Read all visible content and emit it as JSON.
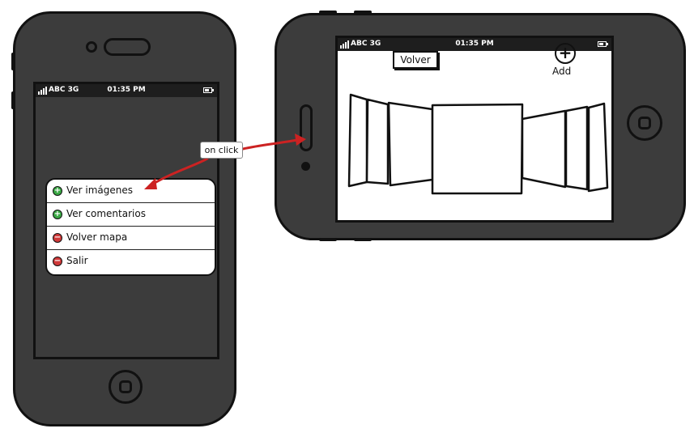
{
  "colors": {
    "phone_body": "#3c3c3c",
    "outline": "#111111",
    "arrow": "#cc2222",
    "add_green": "#3aa844",
    "remove_red": "#d03a3a"
  },
  "portrait": {
    "status": {
      "carrier": "ABC 3G",
      "time": "01:35 PM"
    },
    "menu": {
      "items": [
        {
          "label": "Ver imágenes",
          "icon": "add-circle-icon",
          "icon_glyph": "+"
        },
        {
          "label": "Ver comentarios",
          "icon": "add-circle-icon",
          "icon_glyph": "+"
        },
        {
          "label": "Volver mapa",
          "icon": "remove-circle-icon",
          "icon_glyph": "−"
        },
        {
          "label": "Salir",
          "icon": "remove-circle-icon",
          "icon_glyph": "−"
        }
      ]
    }
  },
  "annotation": {
    "label": "on click"
  },
  "landscape": {
    "status": {
      "carrier": "ABC 3G",
      "time": "01:35 PM"
    },
    "back_button": "Volver",
    "add_label": "Add",
    "add_glyph": "+"
  }
}
